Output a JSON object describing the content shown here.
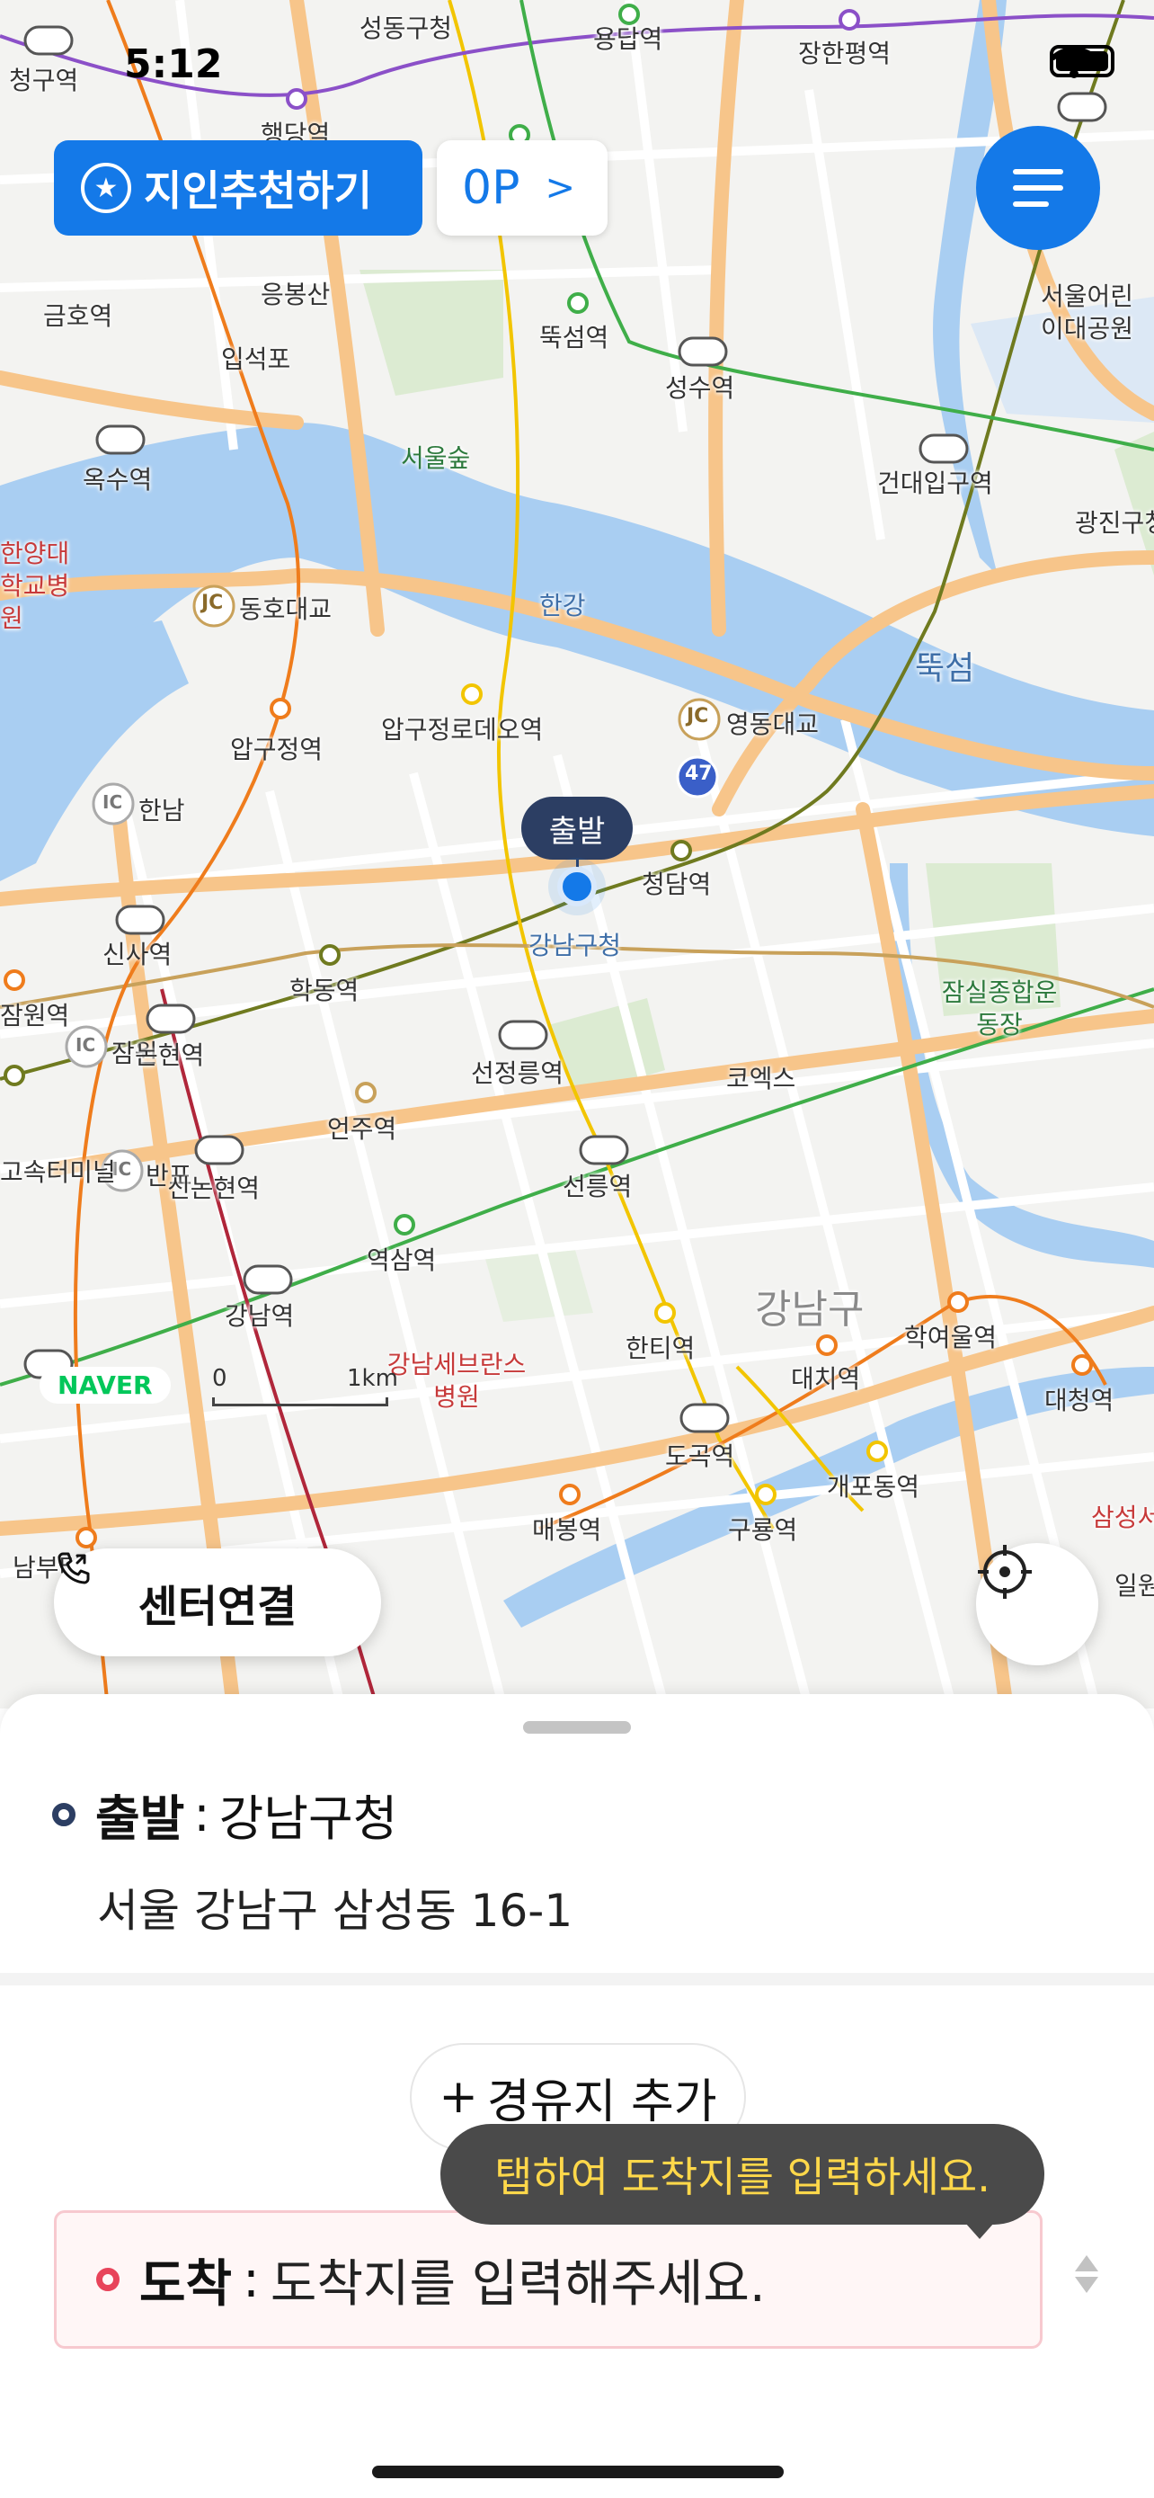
{
  "status_bar": {
    "time": "5:12"
  },
  "header": {
    "recommend_label": "지인추천하기",
    "point_label": "0P",
    "point_chevron": ">"
  },
  "map": {
    "places": {
      "seongdong_gucheong": "성동구청",
      "yongdap": "용답역",
      "janghanpyeong": "장한평역",
      "cheonggu": "청구역",
      "haengdang": "행당역",
      "eungbongsan": "응봉산",
      "geumho": "금호역",
      "ttukseom_station": "뚝섬역",
      "seongsu": "성수역",
      "ipseokpo": "입석포",
      "seoul_forest": "서울숲",
      "children_park": "서울어린이대공원",
      "geondae": "건대입구역",
      "gwangjin_gucheong": "광진구청",
      "oksu": "옥수역",
      "hanyang_univ": "한양대학교병원",
      "hangang": "한강",
      "ttukseom": "뚝섬",
      "dongho_bridge": "동호대교",
      "apgujeong_rodeo": "압구정로데오역",
      "yeongdong_bridge": "영동대교",
      "apgujeong": "압구정역",
      "hannam": "한남",
      "cheongdam": "청담역",
      "gangnam_gucheong": "강남구청",
      "sinsa": "신사역",
      "hakdong": "학동역",
      "jamwon": "잠원역",
      "jamsil_stadium": "잠실종합운동장",
      "jamwon_ic": "잠원",
      "nonhyeon": "논현역",
      "seonjeongneung": "선정릉역",
      "coex": "코엑스",
      "gosok_terminal": "고속터미널",
      "banpo_ic": "반포",
      "sinnonhyeon": "신논현역",
      "eonju": "언주역",
      "seolleung": "선릉역",
      "yeoksam": "역삼역",
      "gangnam_gu": "강남구",
      "gangnam_station": "강남역",
      "hanti": "한티역",
      "hagyeoul": "학여울역",
      "daechi": "대치역",
      "severance": "강남세브란스병원",
      "daecheong": "대청역",
      "dogok": "도곡역",
      "gaepodong": "개포동역",
      "maebong": "매봉역",
      "guryong": "구룡역",
      "samsung_hospital": "삼성서울병원",
      "irwon": "일원",
      "nambu": "남부터미널",
      "ic": "IC",
      "jc": "JC",
      "route47": "47"
    },
    "origin_tag": "출발",
    "logo": "NAVER",
    "scale_zero": "0",
    "scale_unit": "1km",
    "center_button_label": "센터연결"
  },
  "sheet": {
    "origin_key": "출발",
    "origin_sep": ":",
    "origin_name": "강남구청",
    "origin_address": "서울 강남구 삼성동 16-1",
    "waypoint_plus": "+",
    "waypoint_label": "경유지 추가",
    "tooltip": "탭하여 도착지를 입력하세요.",
    "dest_key": "도착",
    "dest_sep": ":",
    "dest_placeholder": "도착지를 입력해주세요."
  },
  "colors": {
    "brand_blue": "#1479e8",
    "origin_navy": "#2c3e63",
    "dest_red": "#e8445a",
    "tooltip_text": "#ffd84a",
    "water": "#a9cef2",
    "road": "#f7c58a",
    "line2_green": "#3fae49",
    "line7_olive": "#6f7a1f",
    "bundang_yellow": "#f2c500",
    "line3_orange": "#ef7c1c",
    "sinbundang_red": "#b0263a",
    "line5_purple": "#8b50c8"
  }
}
